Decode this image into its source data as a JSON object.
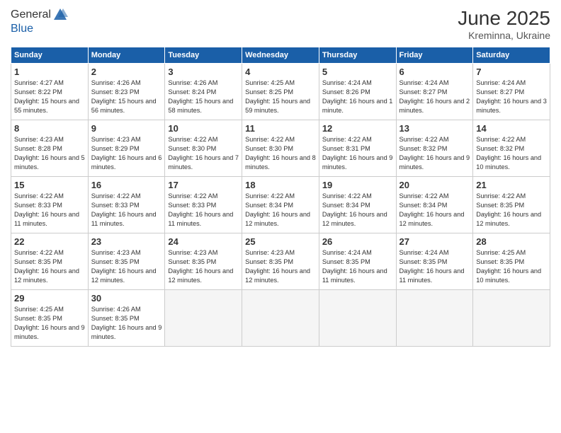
{
  "header": {
    "logo_general": "General",
    "logo_blue": "Blue",
    "month_year": "June 2025",
    "location": "Kreminna, Ukraine"
  },
  "days_of_week": [
    "Sunday",
    "Monday",
    "Tuesday",
    "Wednesday",
    "Thursday",
    "Friday",
    "Saturday"
  ],
  "weeks": [
    [
      {
        "day": 1,
        "sunrise": "4:27 AM",
        "sunset": "8:22 PM",
        "daylight": "15 hours and 55 minutes."
      },
      {
        "day": 2,
        "sunrise": "4:26 AM",
        "sunset": "8:23 PM",
        "daylight": "15 hours and 56 minutes."
      },
      {
        "day": 3,
        "sunrise": "4:26 AM",
        "sunset": "8:24 PM",
        "daylight": "15 hours and 58 minutes."
      },
      {
        "day": 4,
        "sunrise": "4:25 AM",
        "sunset": "8:25 PM",
        "daylight": "15 hours and 59 minutes."
      },
      {
        "day": 5,
        "sunrise": "4:24 AM",
        "sunset": "8:26 PM",
        "daylight": "16 hours and 1 minute."
      },
      {
        "day": 6,
        "sunrise": "4:24 AM",
        "sunset": "8:27 PM",
        "daylight": "16 hours and 2 minutes."
      },
      {
        "day": 7,
        "sunrise": "4:24 AM",
        "sunset": "8:27 PM",
        "daylight": "16 hours and 3 minutes."
      }
    ],
    [
      {
        "day": 8,
        "sunrise": "4:23 AM",
        "sunset": "8:28 PM",
        "daylight": "16 hours and 5 minutes."
      },
      {
        "day": 9,
        "sunrise": "4:23 AM",
        "sunset": "8:29 PM",
        "daylight": "16 hours and 6 minutes."
      },
      {
        "day": 10,
        "sunrise": "4:22 AM",
        "sunset": "8:30 PM",
        "daylight": "16 hours and 7 minutes."
      },
      {
        "day": 11,
        "sunrise": "4:22 AM",
        "sunset": "8:30 PM",
        "daylight": "16 hours and 8 minutes."
      },
      {
        "day": 12,
        "sunrise": "4:22 AM",
        "sunset": "8:31 PM",
        "daylight": "16 hours and 9 minutes."
      },
      {
        "day": 13,
        "sunrise": "4:22 AM",
        "sunset": "8:32 PM",
        "daylight": "16 hours and 9 minutes."
      },
      {
        "day": 14,
        "sunrise": "4:22 AM",
        "sunset": "8:32 PM",
        "daylight": "16 hours and 10 minutes."
      }
    ],
    [
      {
        "day": 15,
        "sunrise": "4:22 AM",
        "sunset": "8:33 PM",
        "daylight": "16 hours and 11 minutes."
      },
      {
        "day": 16,
        "sunrise": "4:22 AM",
        "sunset": "8:33 PM",
        "daylight": "16 hours and 11 minutes."
      },
      {
        "day": 17,
        "sunrise": "4:22 AM",
        "sunset": "8:33 PM",
        "daylight": "16 hours and 11 minutes."
      },
      {
        "day": 18,
        "sunrise": "4:22 AM",
        "sunset": "8:34 PM",
        "daylight": "16 hours and 12 minutes."
      },
      {
        "day": 19,
        "sunrise": "4:22 AM",
        "sunset": "8:34 PM",
        "daylight": "16 hours and 12 minutes."
      },
      {
        "day": 20,
        "sunrise": "4:22 AM",
        "sunset": "8:34 PM",
        "daylight": "16 hours and 12 minutes."
      },
      {
        "day": 21,
        "sunrise": "4:22 AM",
        "sunset": "8:35 PM",
        "daylight": "16 hours and 12 minutes."
      }
    ],
    [
      {
        "day": 22,
        "sunrise": "4:22 AM",
        "sunset": "8:35 PM",
        "daylight": "16 hours and 12 minutes."
      },
      {
        "day": 23,
        "sunrise": "4:23 AM",
        "sunset": "8:35 PM",
        "daylight": "16 hours and 12 minutes."
      },
      {
        "day": 24,
        "sunrise": "4:23 AM",
        "sunset": "8:35 PM",
        "daylight": "16 hours and 12 minutes."
      },
      {
        "day": 25,
        "sunrise": "4:23 AM",
        "sunset": "8:35 PM",
        "daylight": "16 hours and 12 minutes."
      },
      {
        "day": 26,
        "sunrise": "4:24 AM",
        "sunset": "8:35 PM",
        "daylight": "16 hours and 11 minutes."
      },
      {
        "day": 27,
        "sunrise": "4:24 AM",
        "sunset": "8:35 PM",
        "daylight": "16 hours and 11 minutes."
      },
      {
        "day": 28,
        "sunrise": "4:25 AM",
        "sunset": "8:35 PM",
        "daylight": "16 hours and 10 minutes."
      }
    ],
    [
      {
        "day": 29,
        "sunrise": "4:25 AM",
        "sunset": "8:35 PM",
        "daylight": "16 hours and 9 minutes."
      },
      {
        "day": 30,
        "sunrise": "4:26 AM",
        "sunset": "8:35 PM",
        "daylight": "16 hours and 9 minutes."
      },
      null,
      null,
      null,
      null,
      null
    ]
  ]
}
